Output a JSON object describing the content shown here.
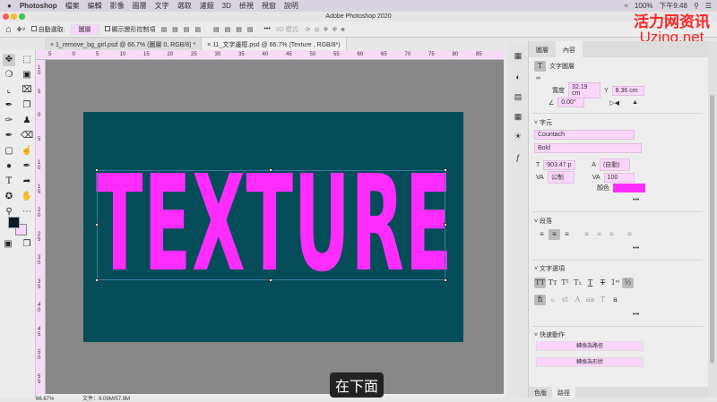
{
  "menubar": {
    "apple": "",
    "app": "Photoshop",
    "items": [
      "檔案",
      "編輯",
      "影像",
      "圖層",
      "文字",
      "選取",
      "濾鏡",
      "3D",
      "檢視",
      "視窗",
      "說明"
    ],
    "battery": "100%",
    "time": "下午9:48"
  },
  "window": {
    "title": "Adobe Photoshop 2020"
  },
  "watermark": {
    "cn": "活力网资讯",
    "en": "Uzing.net"
  },
  "options": {
    "auto_select_label": "自動選取:",
    "auto_select_value": "圖層",
    "show_transform_label": "顯示變形控制項",
    "mode_3d": "3D 模式:",
    "more": "•••"
  },
  "tabs": [
    {
      "label": "1_remove_bg_girl.psd @ 66.7% (圖層 0, RGB/8) *"
    },
    {
      "label": "11_文字邊框.psd @ 66.7% (Texture , RGB/8*)"
    }
  ],
  "ruler": {
    "top": [
      "5",
      "0",
      "5",
      "10",
      "15",
      "20",
      "25",
      "30",
      "35",
      "40",
      "45",
      "50",
      "55",
      "60",
      "65",
      "70",
      "75",
      "80",
      "85"
    ],
    "left": [
      "10",
      "5",
      "0",
      "5",
      "10",
      "15",
      "20",
      "25",
      "30",
      "35",
      "40",
      "45",
      "50",
      "55"
    ]
  },
  "canvas": {
    "text": "TEXTURE",
    "text_color": "#ff2cff",
    "bg_color": "#044c58"
  },
  "status": {
    "zoom": "66.67%",
    "doc": "文件：9.09M/57.9M"
  },
  "subtitle": "在下面",
  "panel": {
    "tabs": [
      "圖層",
      "內容"
    ],
    "layer_type": "文字圖層",
    "w_label": "寬度",
    "w_value": "32.19 cm",
    "y_label": "Y",
    "y_value": "8.36 cm",
    "angle": "0.00°",
    "char_title": "字元",
    "font": "Countach",
    "style": "Bold",
    "size": "903.47 p",
    "leading": "(自動)",
    "kerning": "公制",
    "tracking": "100",
    "color_label": "顏色",
    "color": "#ff2cff",
    "para_title": "段落",
    "textopt_title": "文字選項",
    "quick_title": "快速動作",
    "btn_path": "轉換為路徑",
    "btn_shape": "轉換為形狀",
    "more": "•••",
    "bottom_tabs": [
      "色版",
      "路徑"
    ]
  }
}
